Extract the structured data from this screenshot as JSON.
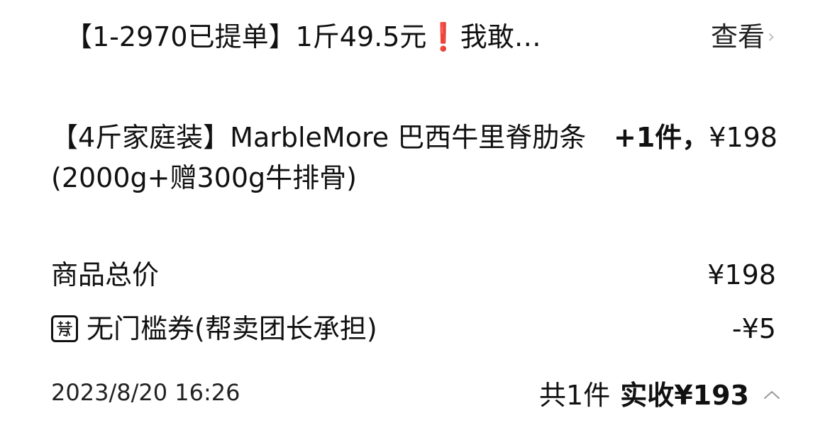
{
  "order": {
    "group_title": "【1-2970已提单】1斤49.5元❗我敢…",
    "view_label": "查看",
    "view_chevron": "›",
    "product": {
      "name": "【4斤家庭装】MarbleMore 巴西牛里脊肋条(2000g+赠300g牛排骨)",
      "quantity": "+1件，",
      "price": "¥198"
    },
    "summary": {
      "goods_total_label": "商品总价",
      "goods_total_value": "¥198",
      "coupon_label": "无门槛券(帮卖团长承担)",
      "coupon_value": "-¥5",
      "coupon_icon": "coupon-icon"
    },
    "footer": {
      "order_time": "2023/8/20 16:26",
      "total_count": "共1件",
      "paid_label": "实收¥193",
      "collapse_icon": "chevron-up-icon"
    }
  },
  "colors": {
    "text": "#111111",
    "muted": "#bbbbbb",
    "background": "#ffffff"
  }
}
